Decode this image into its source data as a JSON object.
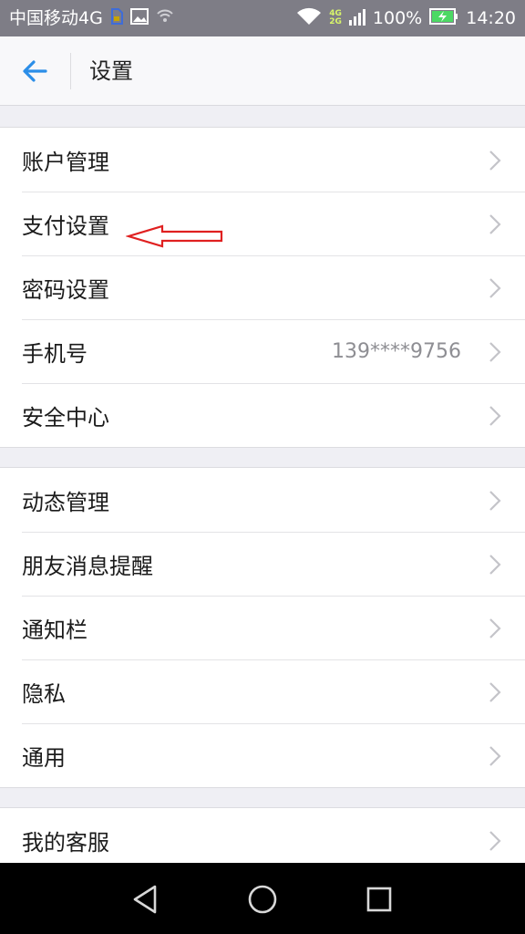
{
  "status_bar": {
    "carrier": "中国移动4G",
    "net_top": "4G",
    "net_bottom": "2G",
    "battery": "100%",
    "time": "14:20"
  },
  "header": {
    "title": "设置"
  },
  "groups": [
    {
      "items": [
        {
          "label": "账户管理"
        },
        {
          "label": "支付设置"
        },
        {
          "label": "密码设置"
        },
        {
          "label": "手机号",
          "value": "139****9756"
        },
        {
          "label": "安全中心"
        }
      ]
    },
    {
      "items": [
        {
          "label": "动态管理"
        },
        {
          "label": "朋友消息提醒"
        },
        {
          "label": "通知栏"
        },
        {
          "label": "隐私"
        },
        {
          "label": "通用"
        }
      ]
    },
    {
      "items": [
        {
          "label": "我的客服"
        }
      ]
    }
  ],
  "colors": {
    "accent": "#2b8ee8",
    "annotation": "#e02020",
    "status_bar_bg": "#7e7d86",
    "page_bg": "#efeff4"
  },
  "icons": {
    "back": "arrow-left-icon",
    "chevron": "chevron-right-icon",
    "nav": [
      "back-triangle-icon",
      "home-circle-icon",
      "recents-square-icon"
    ]
  }
}
